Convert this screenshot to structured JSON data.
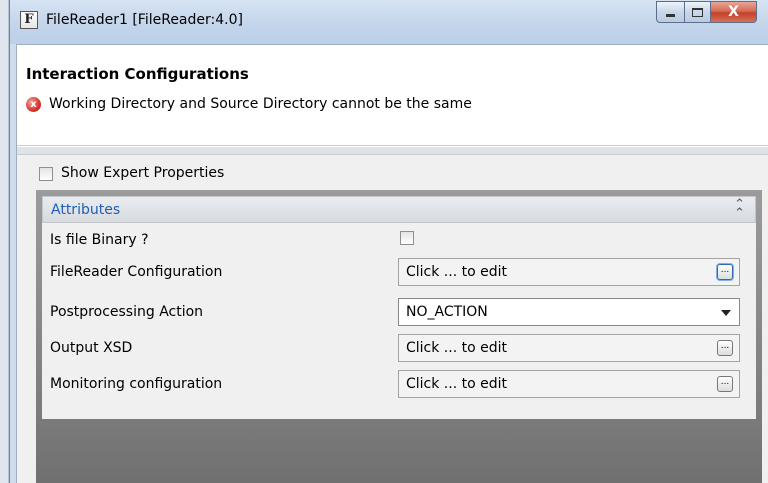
{
  "window": {
    "title": "FileReader1 [FileReader:4.0]",
    "icon_glyph": "F",
    "close_glyph": "X"
  },
  "header": {
    "title": "Interaction Configurations",
    "error_icon_glyph": "x",
    "error_message": "Working Directory and Source Directory cannot be the same"
  },
  "expert": {
    "label": "Show Expert Properties",
    "checked": false
  },
  "attributes": {
    "title": "Attributes",
    "collapse_glyph": "»",
    "rows": [
      {
        "label": "Is file Binary ?",
        "type": "checkbox",
        "checked": false
      },
      {
        "label": "FileReader Configuration",
        "type": "edit",
        "value": "Click ... to edit",
        "button": "..."
      },
      {
        "label": "Postprocessing Action",
        "type": "select",
        "value": "NO_ACTION"
      },
      {
        "label": "Output XSD",
        "type": "edit",
        "value": "Click ... to edit",
        "button": "..."
      },
      {
        "label": "Monitoring configuration",
        "type": "edit",
        "value": "Click ... to edit",
        "button": "..."
      }
    ]
  },
  "colors": {
    "section_title": "#1f5fb0",
    "error_red": "#d8332a",
    "close_button": "#c3412a"
  },
  "icons": [
    "filereader-app-icon",
    "minimize-icon",
    "maximize-icon",
    "close-icon",
    "error-icon",
    "collapse-icon",
    "ellipsis-icon",
    "dropdown-caret-icon"
  ]
}
